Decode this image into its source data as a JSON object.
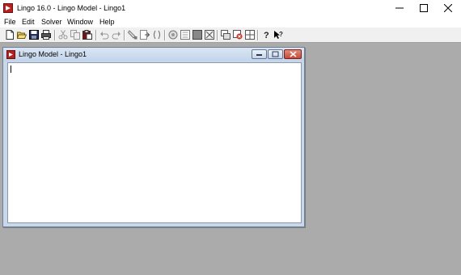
{
  "app": {
    "title": "Lingo 16.0 - Lingo Model - Lingo1",
    "icon": "lingo-app-icon",
    "window_controls": [
      "minimize-icon",
      "maximize-icon",
      "close-icon"
    ]
  },
  "menu": {
    "items": [
      {
        "label": "File"
      },
      {
        "label": "Edit"
      },
      {
        "label": "Solver"
      },
      {
        "label": "Window"
      },
      {
        "label": "Help"
      }
    ]
  },
  "toolbar": {
    "buttons": [
      {
        "name": "new-icon"
      },
      {
        "name": "open-icon"
      },
      {
        "name": "save-icon"
      },
      {
        "name": "print-icon"
      },
      {
        "name": "cut-icon"
      },
      {
        "name": "copy-icon"
      },
      {
        "name": "paste-icon"
      },
      {
        "name": "undo-icon"
      },
      {
        "name": "redo-icon"
      },
      {
        "name": "find-icon"
      },
      {
        "name": "goto-line-icon"
      },
      {
        "name": "match-parenthesis-icon"
      },
      {
        "name": "solve-icon"
      },
      {
        "name": "solution-icon"
      },
      {
        "name": "matrix-picture-icon"
      },
      {
        "name": "options-icon"
      },
      {
        "name": "send-to-back-icon"
      },
      {
        "name": "close-all-icon"
      },
      {
        "name": "tile-icon"
      },
      {
        "name": "help-topics-icon"
      },
      {
        "name": "context-help-icon"
      }
    ]
  },
  "document": {
    "title": "Lingo Model - Lingo1",
    "icon": "lingo-model-icon",
    "content": ""
  },
  "colors": {
    "workspace": "#ababab",
    "brand_red": "#b5211f",
    "child_titlebar": "#c9d8ea",
    "close_red": "#c34a36"
  }
}
